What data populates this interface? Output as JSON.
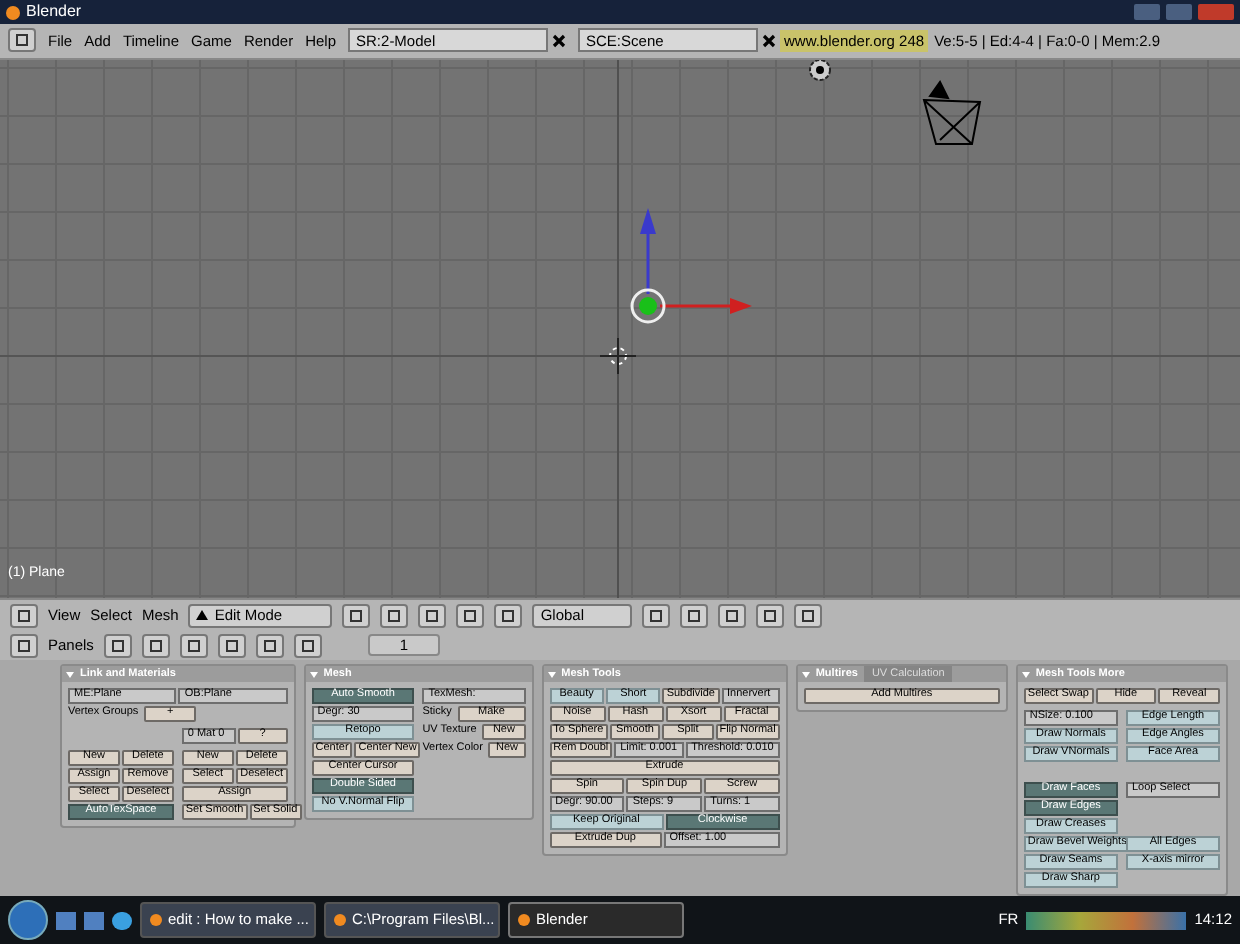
{
  "window": {
    "title": "Blender"
  },
  "top_bar": {
    "menus": [
      "File",
      "Add",
      "Timeline",
      "Game",
      "Render",
      "Help"
    ],
    "screen": "SR:2-Model",
    "scene": "SCE:Scene",
    "version": "www.blender.org 248",
    "stats": "Ve:5-5 | Ed:4-4 | Fa:0-0 | Mem:2.9"
  },
  "viewport": {
    "object_label": "(1) Plane"
  },
  "view_header": {
    "menus": [
      "View",
      "Select",
      "Mesh"
    ],
    "mode": "Edit Mode",
    "orientation": "Global"
  },
  "buttons_header": {
    "label": "Panels",
    "frame": "1"
  },
  "panels": [
    {
      "title": "Link and Materials",
      "blocks": [
        {
          "rows": [
            [
              {
                "kind": "field",
                "label": "ME:Plane"
              },
              {
                "kind": "field",
                "label": "OB:Plane"
              }
            ],
            [
              {
                "kind": "label",
                "label": "Vertex Groups"
              },
              {
                "kind": "button",
                "label": "+"
              },
              {
                "kind": "spacer"
              },
              {
                "kind": "spacer"
              }
            ]
          ]
        },
        {
          "columns": [
            [
              [
                {
                  "kind": "spacer"
                }
              ]
            ],
            [
              [
                {
                  "kind": "field",
                  "label": "0 Mat 0"
                },
                {
                  "kind": "button",
                  "label": "?"
                }
              ]
            ]
          ]
        },
        {
          "columns": [
            [
              [
                {
                  "kind": "button",
                  "label": "New"
                },
                {
                  "kind": "button",
                  "label": "Delete"
                }
              ],
              [
                {
                  "kind": "button",
                  "label": "Assign"
                },
                {
                  "kind": "button",
                  "label": "Remove"
                }
              ],
              [
                {
                  "kind": "button",
                  "label": "Select"
                },
                {
                  "kind": "button",
                  "label": "Deselect"
                }
              ],
              [
                {
                  "kind": "toggle",
                  "label": "AutoTexSpace",
                  "on": true
                }
              ]
            ],
            [
              [
                {
                  "kind": "button",
                  "label": "New"
                },
                {
                  "kind": "button",
                  "label": "Delete"
                }
              ],
              [
                {
                  "kind": "button",
                  "label": "Select"
                },
                {
                  "kind": "button",
                  "label": "Deselect"
                }
              ],
              [
                {
                  "kind": "button",
                  "label": "Assign"
                }
              ],
              [
                {
                  "kind": "button",
                  "label": "Set Smooth"
                },
                {
                  "kind": "button",
                  "label": "Set Solid"
                }
              ]
            ]
          ]
        }
      ]
    },
    {
      "title": "Mesh",
      "blocks": [
        {
          "columns": [
            [
              [
                {
                  "kind": "toggle",
                  "label": "Auto Smooth",
                  "on": true
                }
              ],
              [
                {
                  "kind": "field",
                  "label": "Degr: 30"
                }
              ],
              [
                {
                  "kind": "toggle",
                  "label": "Retopo",
                  "on": false
                }
              ],
              [
                {
                  "kind": "button",
                  "label": "Center"
                },
                {
                  "kind": "button",
                  "label": "Center New"
                }
              ],
              [
                {
                  "kind": "button",
                  "label": "Center Cursor"
                }
              ],
              [
                {
                  "kind": "toggle",
                  "label": "Double Sided",
                  "on": true
                }
              ],
              [
                {
                  "kind": "toggle",
                  "label": "No V.Normal Flip",
                  "on": false
                }
              ]
            ],
            [
              [
                {
                  "kind": "field",
                  "label": "TexMesh:"
                }
              ],
              [
                {
                  "kind": "label",
                  "label": "Sticky"
                },
                {
                  "kind": "button",
                  "label": "Make"
                }
              ],
              [
                {
                  "kind": "label",
                  "label": "UV Texture"
                },
                {
                  "kind": "button",
                  "label": "New"
                }
              ],
              [
                {
                  "kind": "label",
                  "label": "Vertex Color"
                },
                {
                  "kind": "button",
                  "label": "New"
                }
              ]
            ]
          ]
        }
      ]
    },
    {
      "title": "Mesh Tools",
      "blocks": [
        {
          "rows": [
            [
              {
                "kind": "toggle",
                "label": "Beauty",
                "on": false
              },
              {
                "kind": "toggle",
                "label": "Short",
                "on": false
              },
              {
                "kind": "button",
                "label": "Subdivide"
              },
              {
                "kind": "field",
                "label": "Innervert"
              }
            ],
            [
              {
                "kind": "button",
                "label": "Noise"
              },
              {
                "kind": "button",
                "label": "Hash"
              },
              {
                "kind": "button",
                "label": "Xsort"
              },
              {
                "kind": "button",
                "label": "Fractal"
              }
            ],
            [
              {
                "kind": "button",
                "label": "To Sphere"
              },
              {
                "kind": "button",
                "label": "Smooth"
              },
              {
                "kind": "button",
                "label": "Split"
              },
              {
                "kind": "button",
                "label": "Flip Normal"
              }
            ],
            [
              {
                "kind": "button",
                "label": "Rem Doubl"
              },
              {
                "kind": "field",
                "label": "Limit: 0.001"
              },
              {
                "kind": "field",
                "label": "Threshold: 0.010"
              }
            ],
            [
              {
                "kind": "button",
                "label": "Extrude"
              }
            ],
            [
              {
                "kind": "button",
                "label": "Spin"
              },
              {
                "kind": "button",
                "label": "Spin Dup"
              },
              {
                "kind": "button",
                "label": "Screw"
              }
            ],
            [
              {
                "kind": "field",
                "label": "Degr: 90.00"
              },
              {
                "kind": "field",
                "label": "Steps: 9"
              },
              {
                "kind": "field",
                "label": "Turns: 1"
              }
            ],
            [
              {
                "kind": "toggle",
                "label": "Keep Original",
                "on": false
              },
              {
                "kind": "toggle",
                "label": "Clockwise",
                "on": true
              }
            ],
            [
              {
                "kind": "button",
                "label": "Extrude Dup"
              },
              {
                "kind": "field",
                "label": "Offset: 1.00"
              }
            ]
          ]
        }
      ]
    },
    {
      "title": "Multires",
      "tab": "UV Calculation",
      "blocks": [
        {
          "rows": [
            [
              {
                "kind": "button",
                "label": "Add Multires"
              }
            ]
          ]
        }
      ]
    },
    {
      "title": "Mesh Tools More",
      "blocks": [
        {
          "rows": [
            [
              {
                "kind": "button",
                "label": "Select Swap"
              },
              {
                "kind": "button",
                "label": "Hide"
              },
              {
                "kind": "button",
                "label": "Reveal"
              }
            ]
          ]
        },
        {
          "columns": [
            [
              [
                {
                  "kind": "field",
                  "label": "NSize: 0.100"
                }
              ],
              [
                {
                  "kind": "toggle",
                  "label": "Draw Normals",
                  "on": false
                }
              ],
              [
                {
                  "kind": "toggle",
                  "label": "Draw VNormals",
                  "on": false
                }
              ],
              [
                {
                  "kind": "spacer"
                }
              ],
              [
                {
                  "kind": "toggle",
                  "label": "Draw Faces",
                  "on": true
                }
              ],
              [
                {
                  "kind": "toggle",
                  "label": "Draw Edges",
                  "on": true
                }
              ],
              [
                {
                  "kind": "toggle",
                  "label": "Draw Creases",
                  "on": false
                }
              ],
              [
                {
                  "kind": "toggle",
                  "label": "Draw Bevel Weights",
                  "on": false
                }
              ],
              [
                {
                  "kind": "toggle",
                  "label": "Draw Seams",
                  "on": false
                }
              ],
              [
                {
                  "kind": "toggle",
                  "label": "Draw Sharp",
                  "on": false
                }
              ]
            ],
            [
              [
                {
                  "kind": "toggle",
                  "label": "Edge Length",
                  "on": false
                }
              ],
              [
                {
                  "kind": "toggle",
                  "label": "Edge Angles",
                  "on": false
                }
              ],
              [
                {
                  "kind": "toggle",
                  "label": "Face Area",
                  "on": false
                }
              ],
              [
                {
                  "kind": "spacer"
                }
              ],
              [
                {
                  "kind": "field",
                  "label": "Loop Select"
                }
              ],
              [
                {
                  "kind": "spacer"
                }
              ],
              [
                {
                  "kind": "spacer"
                }
              ],
              [
                {
                  "kind": "toggle",
                  "label": "All Edges",
                  "on": false
                }
              ],
              [
                {
                  "kind": "toggle",
                  "label": "X-axis mirror",
                  "on": false
                }
              ]
            ]
          ]
        }
      ]
    }
  ],
  "taskbar": {
    "tasks": [
      {
        "label": "edit : How to make ...",
        "selected": false
      },
      {
        "label": "C:\\Program Files\\Bl...",
        "selected": false
      },
      {
        "label": "Blender",
        "selected": true
      }
    ],
    "language": "FR",
    "clock": "14:12"
  }
}
